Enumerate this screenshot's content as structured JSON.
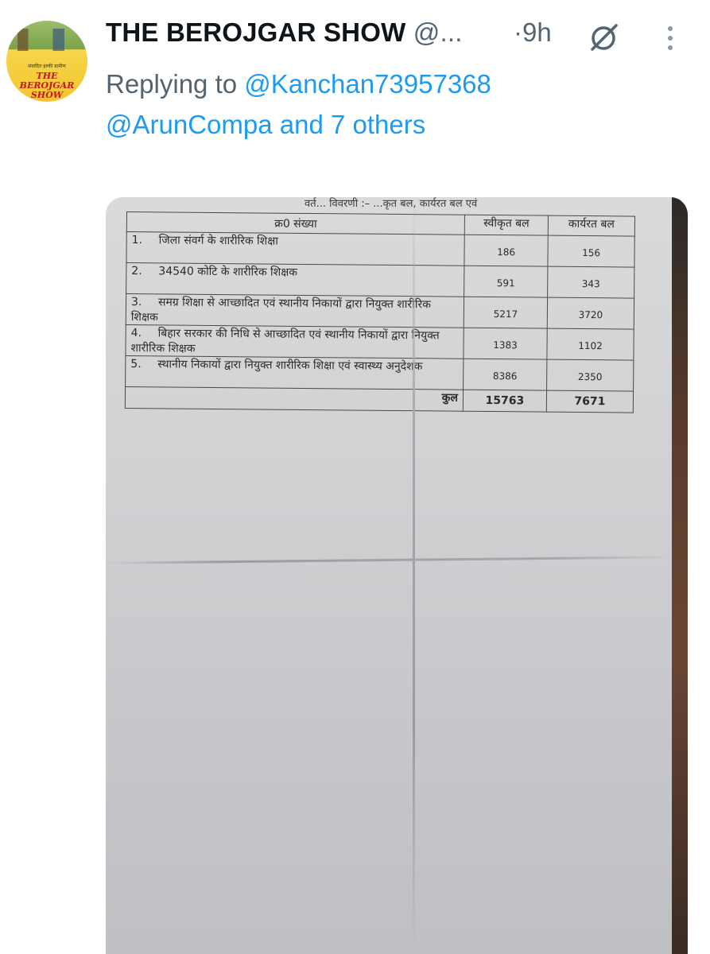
{
  "tweet": {
    "author_name": "THE BEROJGAR SHOW",
    "author_handle": "@...",
    "time": "·9h",
    "replying_prefix": "Replying to",
    "mention_1": "@Kanchan73957368",
    "mention_2": "@ArunCompa",
    "and_others": "and 7 others"
  },
  "avatar": {
    "small_text": "संवादित हल्की ग्रामीण",
    "line1": "THE",
    "line2": "BEROJGAR",
    "line3": "SHOW"
  },
  "icons": {
    "grok": "grok-slash-icon",
    "more": "more-vertical-icon"
  },
  "document": {
    "top_scrap": "वर्त... विवरणी :–                    ...कृत बल, कार्यरत बल एवं",
    "header": {
      "serial": "क्र0 संख्या",
      "sanctioned": "स्वीकृत बल",
      "working": "कार्यरत बल"
    },
    "rows": [
      {
        "no": "1.",
        "desc": "जिला संवर्ग के शारीरिक शिक्षा",
        "sanctioned": "186",
        "working": "156"
      },
      {
        "no": "2.",
        "desc": "34540 कोटि के शारीरिक शिक्षक",
        "sanctioned": "591",
        "working": "343"
      },
      {
        "no": "3.",
        "desc": "समग्र शिक्षा से आच्छादित एवं स्थानीय निकायों द्वारा नियुक्त शारीरिक शिक्षक",
        "sanctioned": "5217",
        "working": "3720"
      },
      {
        "no": "4.",
        "desc": "बिहार सरकार की निधि से आच्छादित एवं स्थानीय निकायों द्वारा नियुक्त शारीरिक शिक्षक",
        "sanctioned": "1383",
        "working": "1102"
      },
      {
        "no": "5.",
        "desc": "स्थानीय निकायों द्वारा नियुक्त शारीरिक शिक्षा एवं स्वास्थ्य अनुदेशक",
        "sanctioned": "8386",
        "working": "2350"
      }
    ],
    "total": {
      "label": "कुल",
      "sanctioned": "15763",
      "working": "7671"
    }
  }
}
